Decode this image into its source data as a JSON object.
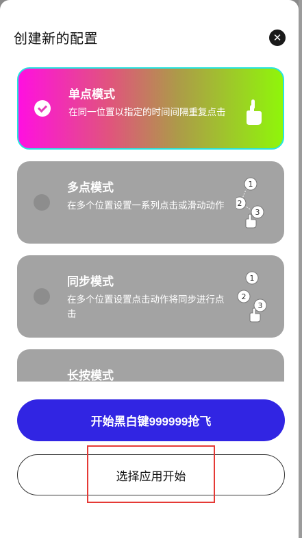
{
  "dialog": {
    "title": "创建新的配置",
    "close_icon": "close-icon"
  },
  "modes": [
    {
      "title": "单点模式",
      "description": "在同一位置以指定的时间间隔重复点击",
      "icon": "single-tap-hand-icon",
      "selected": true
    },
    {
      "title": "多点模式",
      "description": "在多个位置设置一系列点击或滑动动作",
      "icon": "multi-tap-hand-icon",
      "selected": false,
      "steps": [
        "1",
        "2",
        "3"
      ]
    },
    {
      "title": "同步模式",
      "description": "在多个位置设置点击动作将同步进行点击",
      "icon": "sync-tap-hand-icon",
      "selected": false,
      "steps": [
        "1",
        "2",
        "3"
      ]
    },
    {
      "title": "长按模式",
      "description": "",
      "icon": "long-press-icon",
      "selected": false
    }
  ],
  "buttons": {
    "primary_label": "开始黑白键999999抢飞",
    "secondary_label": "选择应用开始"
  },
  "colors": {
    "primary_button": "#3125e3",
    "selected_gradient_start": "#ff10e0",
    "selected_gradient_end": "#8ff60a",
    "selected_border": "#27e4e0",
    "card_gray": "#a3a3a3",
    "highlight_box": "#e53935"
  }
}
